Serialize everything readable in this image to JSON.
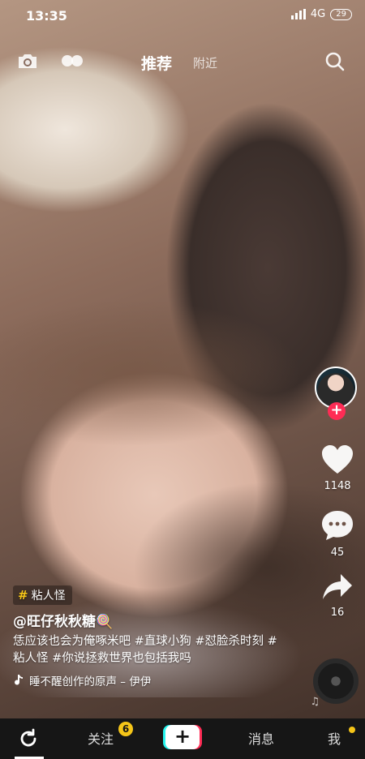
{
  "status_bar": {
    "time": "13:35",
    "network": "4G",
    "battery": "29"
  },
  "top_nav": {
    "tabs": [
      {
        "label": "推荐"
      },
      {
        "label": "附近"
      }
    ]
  },
  "actions": {
    "likes": "1148",
    "comments": "45",
    "shares": "16"
  },
  "caption": {
    "tag": "粘人怪",
    "author": "@旺仔秋秋糖🍭",
    "description": "恁应该也会为俺啄米吧 #直球小狗 #怼脸杀时刻 #粘人怪 #你说拯救世界也包括我吗",
    "music": "睡不醒创作的原声 – 伊伊"
  },
  "bottom_tabs": {
    "follow": "关注",
    "follow_badge": "6",
    "create": "+",
    "messages": "消息",
    "me": "我"
  },
  "colors": {
    "accent_red": "#fe2c55",
    "accent_cyan": "#25f4ee",
    "badge_yellow": "#f5c518"
  }
}
